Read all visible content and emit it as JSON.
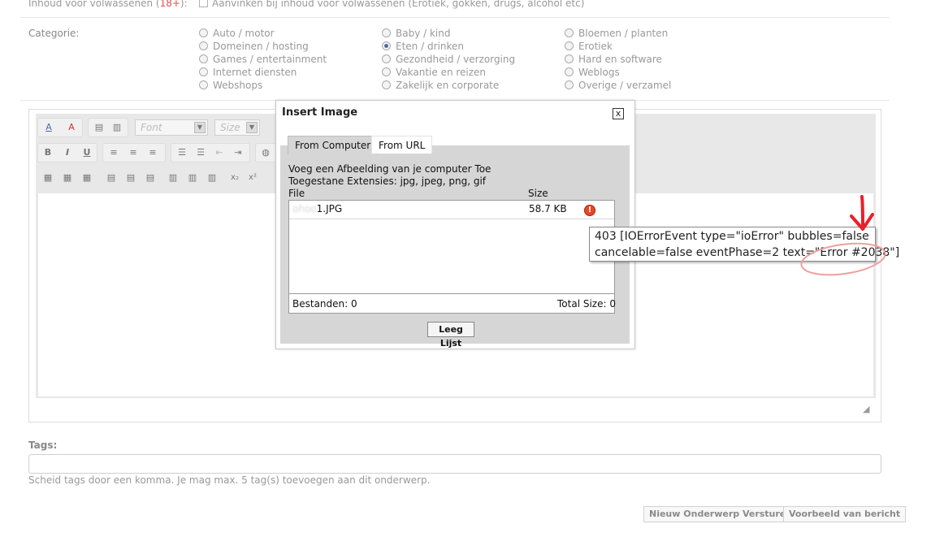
{
  "form": {
    "adult_label": "Inhoud voor volwassenen (",
    "adult_badge": "18+",
    "adult_suffix": "):",
    "adult_checkbox_label": "Aanvinken bij inhoud voor volwassenen (Erotiek, gokken, drugs, alcohol etc)",
    "category_label": "Categorie:",
    "categories": [
      [
        "Auto / motor",
        "Domeinen / hosting",
        "Games / entertainment",
        "Internet diensten",
        "Webshops"
      ],
      [
        "Baby / kind",
        "Eten / drinken",
        "Gezondheid / verzorging",
        "Vakantie en reizen",
        "Zakelijk en corporate"
      ],
      [
        "Bloemen / planten",
        "Erotiek",
        "Hard en software",
        "Weblogs",
        "Overige / verzamel"
      ]
    ],
    "selected_category": "Eten / drinken"
  },
  "toolbar": {
    "font_placeholder": "Font",
    "size_placeholder": "Size"
  },
  "dialog": {
    "title": "Insert Image",
    "close_glyph": "x",
    "tabs": [
      "From Computer",
      "From URL"
    ],
    "intro_line1": "Voeg een Afbeelding van je computer Toe",
    "intro_line2": "Toegestane Extensies: jpg, jpeg, png, gif",
    "col_file": "File",
    "col_size": "Size",
    "file_name_hidden": "ohoo",
    "file_name": "1.JPG",
    "file_size": "58.7 KB",
    "footer_files": "Bestanden: 0",
    "footer_total": "Total Size: 0",
    "clear_button": "Leeg Lijst"
  },
  "tooltip": {
    "line1": "403 [IOErrorEvent type=\"ioError\" bubbles=false",
    "line2": "cancelable=false eventPhase=2 text=\"Error #2038\"]"
  },
  "tags": {
    "label": "Tags:",
    "value": "",
    "hint": "Scheid tags door een komma. Je mag max. 5 tag(s) toevoegen aan dit onderwerp."
  },
  "buttons": {
    "submit": "Nieuw Onderwerp Versturen",
    "preview": "Voorbeeld van bericht"
  },
  "colors": {
    "annotation_red": "#e8202a",
    "error_icon": "#e24a2a"
  }
}
